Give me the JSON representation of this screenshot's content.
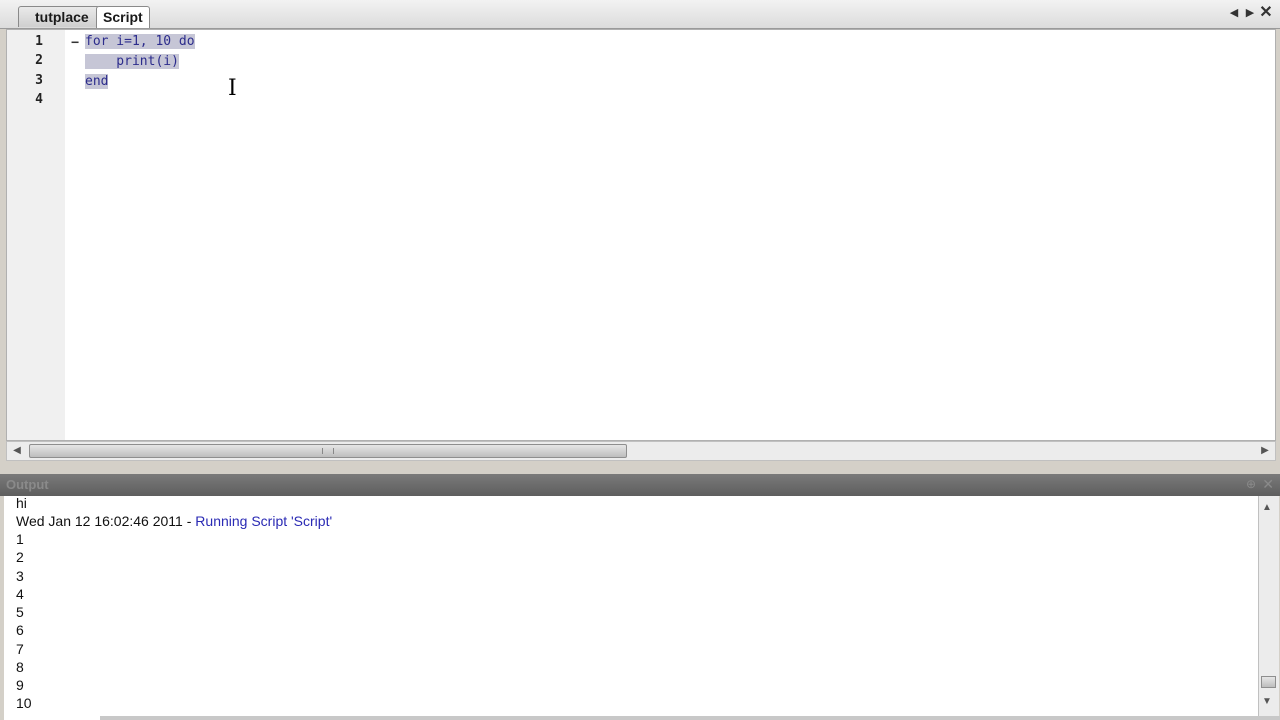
{
  "tabs": [
    {
      "label": "tutplace",
      "active": false
    },
    {
      "label": "Script",
      "active": true
    }
  ],
  "tab_controls": {
    "prev": "◀",
    "next": "▶",
    "close": "✕"
  },
  "editor": {
    "line_numbers": [
      "1",
      "2",
      "3",
      "4"
    ],
    "fold_marker": "−",
    "code_lines": [
      "for i=1, 10 do",
      "    print(i)",
      "end",
      ""
    ]
  },
  "output": {
    "title": "Output",
    "lines": [
      {
        "text": "hi",
        "type": "normal"
      },
      {
        "timestamp": "Wed Jan 12 16:02:46 2011",
        "separator": " - ",
        "message": "Running Script 'Script'",
        "type": "run"
      },
      {
        "text": "1",
        "type": "normal"
      },
      {
        "text": "2",
        "type": "normal"
      },
      {
        "text": "3",
        "type": "normal"
      },
      {
        "text": "4",
        "type": "normal"
      },
      {
        "text": "5",
        "type": "normal"
      },
      {
        "text": "6",
        "type": "normal"
      },
      {
        "text": "7",
        "type": "normal"
      },
      {
        "text": "8",
        "type": "normal"
      },
      {
        "text": "9",
        "type": "normal"
      },
      {
        "text": "10",
        "type": "normal"
      }
    ]
  },
  "colors": {
    "keyword": "#2c2c8c",
    "run_message": "#2a2ab4",
    "selection": "#c6c6d6"
  },
  "icons": {
    "tab_prev": "triangle-left-icon",
    "tab_next": "triangle-right-icon",
    "tab_close": "close-icon",
    "text_cursor": "ibeam-cursor-icon"
  }
}
